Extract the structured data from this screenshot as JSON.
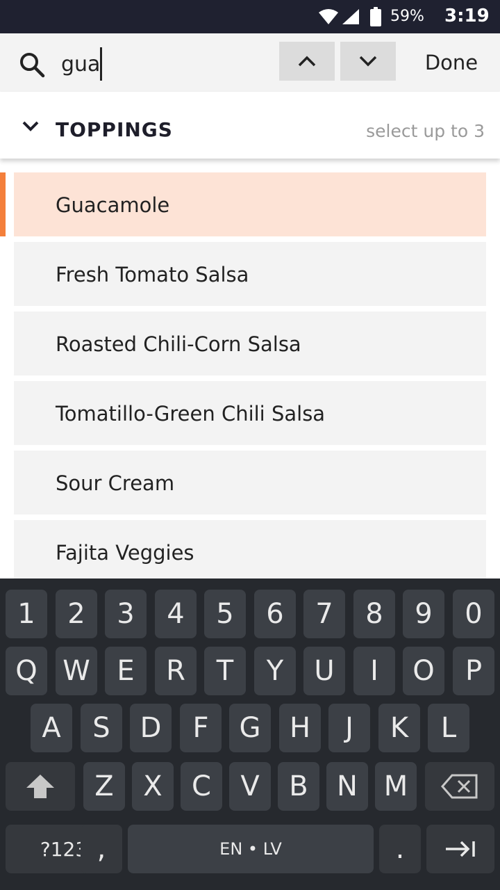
{
  "status_bar": {
    "battery_percent": "59%",
    "time": "3:19",
    "icons": [
      "wifi-icon",
      "signal-icon",
      "battery-icon"
    ]
  },
  "find_bar": {
    "query": "gua",
    "done_label": "Done",
    "icons": [
      "search-icon",
      "chevron-up-icon",
      "chevron-down-icon"
    ]
  },
  "section": {
    "title": "TOPPINGS",
    "hint": "select up to 3",
    "icon": "chevron-down-icon"
  },
  "options": [
    {
      "label": "Guacamole",
      "highlighted": true
    },
    {
      "label": "Fresh Tomato Salsa",
      "highlighted": false
    },
    {
      "label": "Roasted Chili-Corn Salsa",
      "highlighted": false
    },
    {
      "label": "Tomatillo-Green Chili Salsa",
      "highlighted": false
    },
    {
      "label": "Sour Cream",
      "highlighted": false
    },
    {
      "label": "Fajita Veggies",
      "highlighted": false
    }
  ],
  "colors": {
    "highlight_bg": "#fde3d6",
    "accent": "#f47f3b",
    "status_bar_bg": "#1f2130",
    "keyboard_bg": "#26292e"
  },
  "keyboard": {
    "row_numbers": [
      "1",
      "2",
      "3",
      "4",
      "5",
      "6",
      "7",
      "8",
      "9",
      "0"
    ],
    "row_top": [
      "Q",
      "W",
      "E",
      "R",
      "T",
      "Y",
      "U",
      "I",
      "O",
      "P"
    ],
    "row_middle": [
      "A",
      "S",
      "D",
      "F",
      "G",
      "H",
      "J",
      "K",
      "L"
    ],
    "row_bottom": [
      "Z",
      "X",
      "C",
      "V",
      "B",
      "N",
      "M"
    ],
    "symbols_label": "?123",
    "comma_label": ",",
    "space_label": "EN • LV",
    "period_label": ".",
    "icons": [
      "shift-icon",
      "backspace-icon",
      "enter-icon"
    ]
  }
}
